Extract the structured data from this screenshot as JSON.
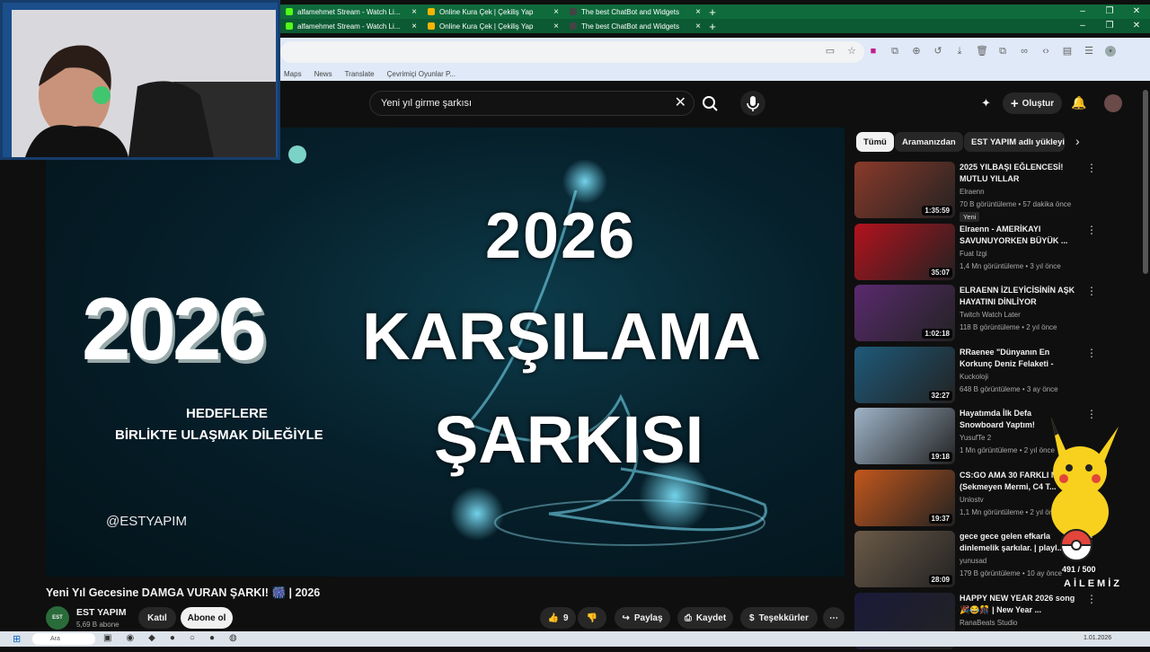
{
  "browser": {
    "tabs_row1": [
      {
        "label": "alfamehmet Stream - Watch Li...",
        "color": "#53fc18"
      },
      {
        "label": "Online Kura Çek | Çekiliş Yap",
        "color": "#f4b400"
      },
      {
        "label": "The best ChatBot and Widgets",
        "color": "#444444"
      }
    ],
    "tabs_row2": [
      {
        "label": "alfamehmet Stream - Watch Li...",
        "color": "#53fc18"
      },
      {
        "label": "Online Kura Çek | Çekiliş Yap",
        "color": "#f4b400"
      },
      {
        "label": "The best ChatBot and Widgets",
        "color": "#444444"
      }
    ],
    "new_tab": "+",
    "bookmarks": [
      "Maps",
      "News",
      "Translate",
      "Çevrimiçi Oyunlar P..."
    ]
  },
  "youtube": {
    "search_query": "Yeni yıl girme şarkısı",
    "create_label": "Oluştur",
    "video": {
      "headline_year": "2026",
      "headline_line1": "KARŞILAMA",
      "headline_line2": "ŞARKISI",
      "side_year": "2026",
      "subtext_line1": "HEDEFLERE",
      "subtext_line2": "BİRLİKTE ULAŞMAK DİLEĞİYLE",
      "handle": "@ESTYAPIM",
      "title": "Yeni Yıl Gecesine DAMGA VURAN ŞARKI! 🎆 | 2026"
    },
    "channel": {
      "avatar_text": "EST",
      "name": "EST YAPIM",
      "subs": "5,69 B abone",
      "join_label": "Katıl",
      "subscribe_label": "Abone ol"
    },
    "actions": {
      "likes": "9",
      "share": "Paylaş",
      "save": "Kaydet",
      "thanks": "Teşekkürler",
      "more": "⋯"
    },
    "chips": [
      "Tümü",
      "Aramanızdan",
      "EST YAPIM adlı yükleyic"
    ],
    "recommendations": [
      {
        "title": "2025 YILBAŞI EĞLENCESİ! MUTLU YILLAR",
        "channel": "Elraenn",
        "meta": "70 B görüntüleme • 57 dakika önce",
        "badge": "Yeni",
        "duration": "1:35:59",
        "color": "#8a3a2a"
      },
      {
        "title": "Elraenn - AMERİKAYI SAVUNUYORKEN BÜYÜK ...",
        "channel": "Fuat Izgi",
        "meta": "1,4 Mn görüntüleme • 3 yıl önce",
        "badge": "",
        "duration": "35:07",
        "color": "#b3121d"
      },
      {
        "title": "ELRAENN İZLEYİCİSİNİN AŞK HAYATINI DİNLİYOR",
        "channel": "Twitch Watch Later",
        "meta": "118 B görüntüleme • 2 yıl önce",
        "badge": "",
        "duration": "1:02:18",
        "color": "#5a2a6e"
      },
      {
        "title": "RRaenee \"Dünyanın En Korkunç Deniz Felaketi - \"Gemiyi ilk ...",
        "channel": "Kuckoloji",
        "meta": "648 B görüntüleme • 3 ay önce",
        "badge": "",
        "duration": "32:27",
        "color": "#1e5a7a"
      },
      {
        "title": "Hayatımda İlk Defa Snowboard Yaptım!",
        "channel": "YusufTe 2",
        "meta": "1 Mn görüntüleme • 2 yıl önce",
        "badge": "",
        "duration": "19:18",
        "color": "#9fb4c8"
      },
      {
        "title": "CS:GO AMA 30 FARKLI MOD (Sekmeyen Mermi, C4 T...",
        "channel": "Unlostv",
        "meta": "1,1 Mn görüntüleme • 2 yıl önce",
        "badge": "",
        "duration": "19:37",
        "color": "#c2571c"
      },
      {
        "title": "gece gece gelen efkarla dinlemelik şarkılar. | playl...",
        "channel": "yunusad",
        "meta": "179 B görüntüleme • 10 ay önce",
        "badge": "",
        "duration": "28:09",
        "color": "#6b5a48"
      },
      {
        "title": "HAPPY NEW YEAR 2026 song 🎉😂🎊 | New Year ...",
        "channel": "RanaBeats Studio",
        "meta": "",
        "badge": "",
        "duration": "",
        "color": "#1a1a3a"
      }
    ]
  },
  "overlay": {
    "counter": "491 / 500",
    "label": "AİLEMİZ"
  },
  "taskbar": {
    "search": "Ara",
    "date": "1.01.2026"
  }
}
